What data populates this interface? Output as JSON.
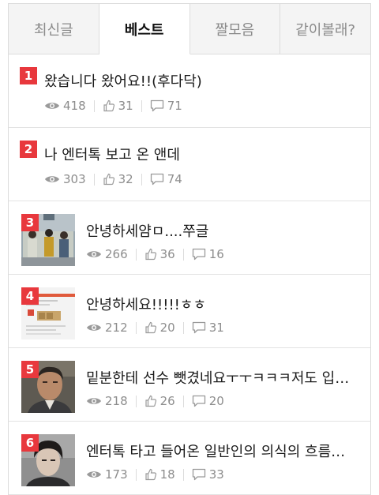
{
  "tabs": [
    {
      "label": "최신글",
      "active": false
    },
    {
      "label": "베스트",
      "active": true
    },
    {
      "label": "짤모음",
      "active": false
    },
    {
      "label": "같이볼래?",
      "active": false
    }
  ],
  "posts": [
    {
      "rank": "1",
      "title": "왔습니다 왔어요!!(후다닥)",
      "views": "418",
      "likes": "31",
      "comments": "71",
      "thumb": null
    },
    {
      "rank": "2",
      "title": "나 엔터톡 보고 온 앤데",
      "views": "303",
      "likes": "32",
      "comments": "74",
      "thumb": null
    },
    {
      "rank": "3",
      "title": "안녕하세얌ㅁ....쭈글",
      "views": "266",
      "likes": "36",
      "comments": "16",
      "thumb": "group-photo"
    },
    {
      "rank": "4",
      "title": "안녕하세요!!!!!ㅎㅎ",
      "views": "212",
      "likes": "20",
      "comments": "31",
      "thumb": "screenshot"
    },
    {
      "rank": "5",
      "title": "밑분한테 선수 뺏겼네요ㅜㅜㅋㅋㅋ저도 입덕...",
      "views": "218",
      "likes": "26",
      "comments": "20",
      "thumb": "man-portrait"
    },
    {
      "rank": "6",
      "title": "엔터톡 타고 들어온 일반인의 의식의 흐름글(...",
      "views": "173",
      "likes": "18",
      "comments": "33",
      "thumb": "boy-portrait"
    }
  ],
  "icons": {
    "views": "eye-icon",
    "likes": "thumbs-up-icon",
    "comments": "comment-icon"
  },
  "colors": {
    "rank_badge": "#e8383d",
    "meta_text": "#8d8d8d",
    "tab_bg": "#f4f4f4"
  }
}
